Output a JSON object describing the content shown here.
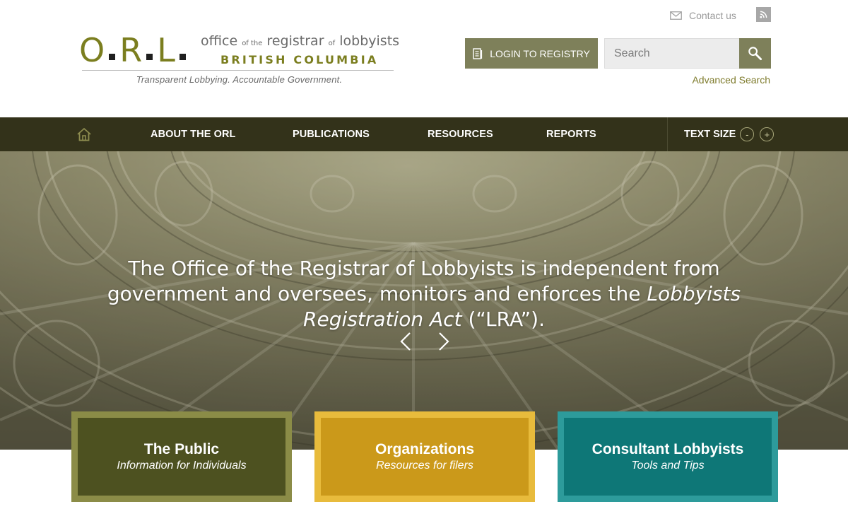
{
  "logo": {
    "letters": [
      "O",
      "R",
      "L"
    ],
    "line1_a": "office",
    "line1_b": "of the",
    "line1_c": "registrar",
    "line1_d": "of",
    "line1_e": "lobbyists",
    "line2": "BRITISH COLUMBIA",
    "tagline": "Transparent Lobbying. Accountable Government."
  },
  "header": {
    "contact_label": "Contact us",
    "login_label": "LOGIN TO REGISTRY",
    "search_placeholder": "Search",
    "advanced_search": "Advanced Search"
  },
  "nav": {
    "items": [
      {
        "label": "ABOUT THE ORL"
      },
      {
        "label": "PUBLICATIONS"
      },
      {
        "label": "RESOURCES"
      },
      {
        "label": "REPORTS"
      }
    ],
    "text_size_label": "TEXT SIZE",
    "decrease": "-",
    "increase": "+"
  },
  "hero": {
    "text_before": "The Office of the Registrar of Lobbyists is independent from government and oversees, monitors and enforces the ",
    "text_italic": "Lobbyists Registration Act",
    "text_after": " (“LRA”)."
  },
  "cards": [
    {
      "title": "The Public",
      "subtitle": "Information for Individuals"
    },
    {
      "title": "Organizations",
      "subtitle": "Resources for filers"
    },
    {
      "title": "Consultant Lobbyists",
      "subtitle": "Tools and Tips"
    }
  ],
  "colors": {
    "olive_dark": "#33321a",
    "olive_button": "#7e805a",
    "logo_olive": "#7b7e1f",
    "card_public": "#4d5120",
    "card_org": "#cb991a",
    "card_cons": "#0e7777"
  },
  "icons": {
    "home": "home-icon",
    "mail": "mail-icon",
    "rss": "rss-icon",
    "login": "document-icon",
    "search": "search-icon",
    "prev": "chevron-left-icon",
    "next": "chevron-right-icon"
  }
}
